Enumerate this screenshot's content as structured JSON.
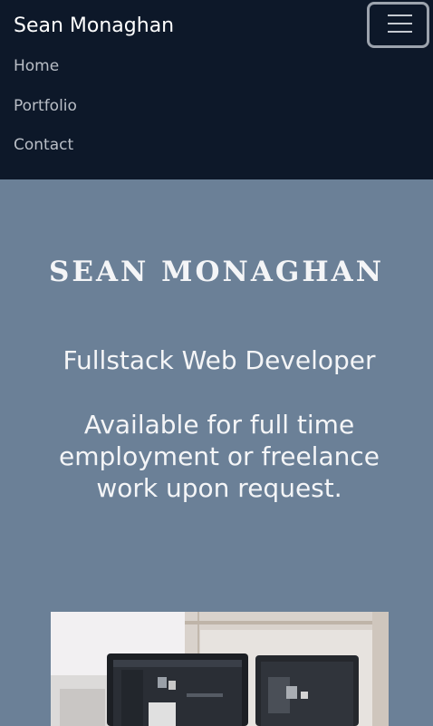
{
  "navbar": {
    "brand": "Sean Monaghan",
    "toggle_icon": "hamburger-menu-icon",
    "links": [
      {
        "label": "Home"
      },
      {
        "label": "Portfolio"
      },
      {
        "label": "Contact"
      }
    ]
  },
  "hero": {
    "title": "SEAN MONAGHAN",
    "role": "Fullstack Web Developer",
    "availability": "Available for full time employment or freelance work upon request."
  },
  "colors": {
    "navbar_bg": "#0d1829",
    "hero_bg": "#6b8097",
    "hero_text": "#f4f5f7"
  }
}
